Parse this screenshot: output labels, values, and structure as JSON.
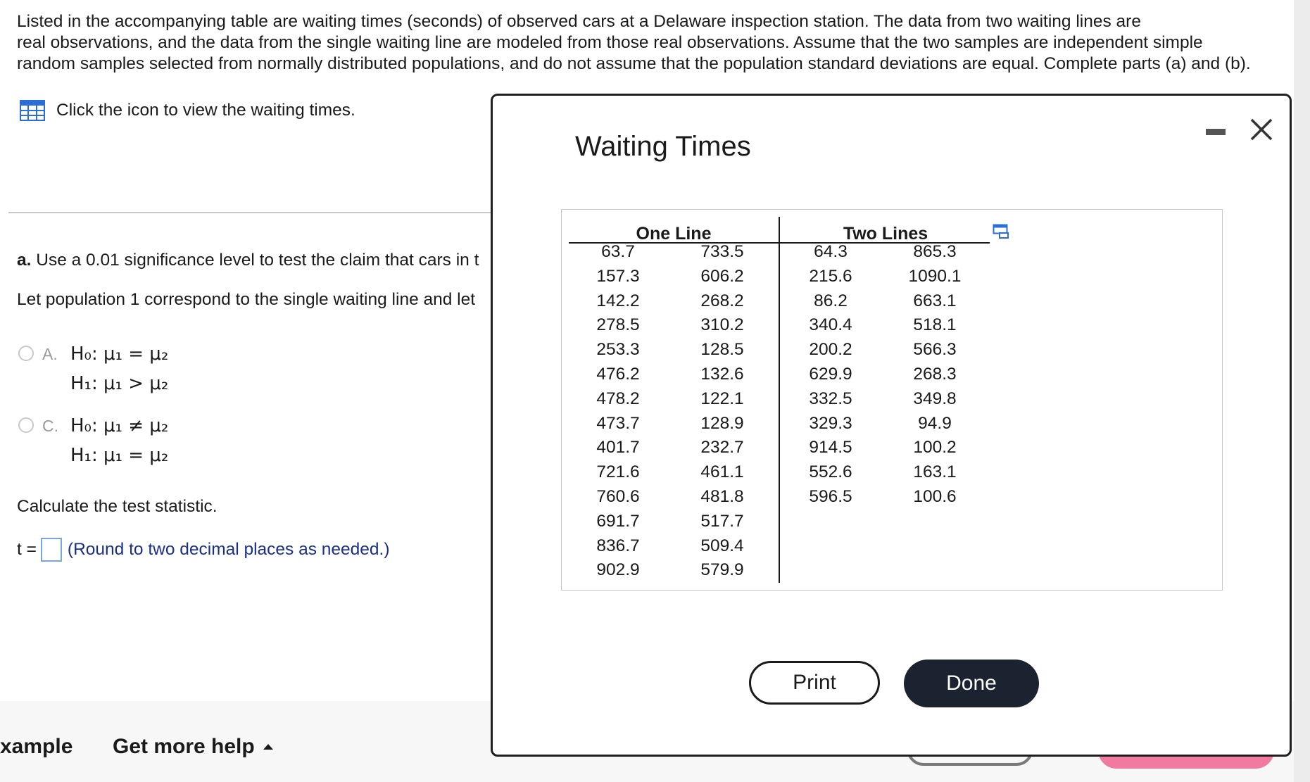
{
  "problem": {
    "intro_lines": [
      "Listed in the accompanying table are waiting times (seconds) of observed cars at a Delaware inspection station. The data from two waiting lines are",
      "real observations, and the data from the single waiting line are modeled from those real observations. Assume that the two samples are independent simple",
      "random samples selected from normally distributed populations, and do not assume that the population standard deviations are equal. Complete parts (a) and (b)."
    ],
    "view_link_text": "Click the icon to view the waiting times.",
    "part_a_label": "a.",
    "part_a_text": "Use a 0.01 significance level to test the claim that cars in t",
    "population_text": "Let population 1 correspond to the single waiting line and let",
    "options": [
      {
        "letter": "A.",
        "h0": "H₀: μ₁ = μ₂",
        "h1": "H₁: μ₁ > μ₂"
      },
      {
        "letter": "C.",
        "h0": "H₀: μ₁ ≠ μ₂",
        "h1": "H₁: μ₁ = μ₂"
      }
    ],
    "calc_text": "Calculate the test statistic.",
    "t_label": "t =",
    "t_value": "",
    "t_hint": "(Round to two decimal places as needed.)"
  },
  "footer": {
    "example_label": "xample",
    "help_label": "Get more help"
  },
  "modal": {
    "title": "Waiting Times",
    "groups": [
      "One Line",
      "Two Lines"
    ],
    "one_line": {
      "col1": [
        "63.7",
        "157.3",
        "142.2",
        "278.5",
        "253.3",
        "476.2",
        "478.2",
        "473.7",
        "401.7",
        "721.6",
        "760.6",
        "691.7",
        "836.7",
        "902.9"
      ],
      "col2": [
        "733.5",
        "606.2",
        "268.2",
        "310.2",
        "128.5",
        "132.6",
        "122.1",
        "128.9",
        "232.7",
        "461.1",
        "481.8",
        "517.7",
        "509.4",
        "579.9"
      ]
    },
    "two_lines": {
      "col1": [
        "64.3",
        "215.6",
        "86.2",
        "340.4",
        "200.2",
        "629.9",
        "332.5",
        "329.3",
        "914.5",
        "552.6",
        "596.5"
      ],
      "col2": [
        "865.3",
        "1090.1",
        "663.1",
        "518.1",
        "566.3",
        "268.3",
        "349.8",
        "94.9",
        "100.2",
        "163.1",
        "100.6"
      ]
    },
    "print_label": "Print",
    "done_label": "Done"
  },
  "colors": {
    "accent_blue": "#2b6fd6",
    "hint_text": "#1a2f8a",
    "done_bg": "#1c2330"
  }
}
